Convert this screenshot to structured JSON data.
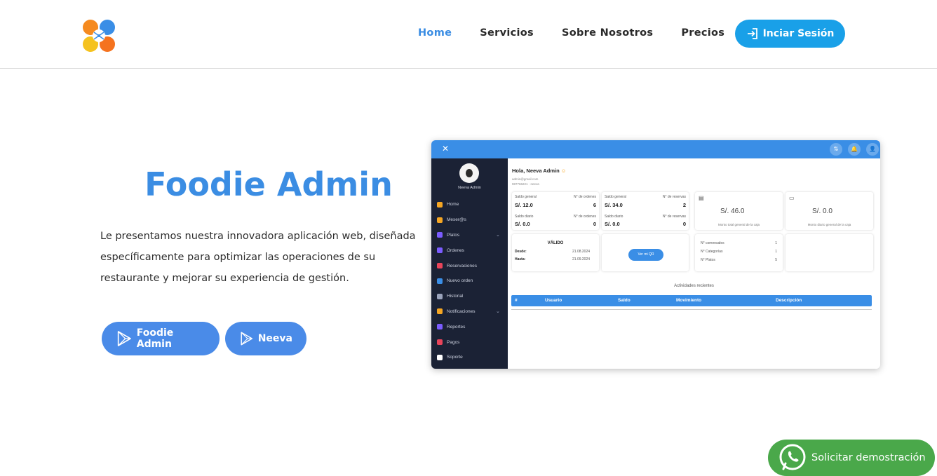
{
  "header": {
    "logo_icon": "foodie-logo-icon",
    "nav": [
      {
        "label": "Home",
        "active": true
      },
      {
        "label": "Servicios",
        "active": false
      },
      {
        "label": "Sobre Nosotros",
        "active": false
      },
      {
        "label": "Precios",
        "active": false
      }
    ],
    "login_label": "Inciar Sesión"
  },
  "hero": {
    "title": "Foodie Admin",
    "text": "Le presentamos nuestra innovadora aplicación web, diseñada específicamente para optimizar las operaciones de su restaurante y mejorar su experiencia de gestión.",
    "buttons": [
      {
        "label": "Foodie Admin",
        "icon": "play-store-icon"
      },
      {
        "label": "Neeva",
        "icon": "play-store-icon"
      }
    ]
  },
  "mockup": {
    "sidebar_user": "Neeva Admin",
    "menu": [
      {
        "label": "Home",
        "color": "#f5a623"
      },
      {
        "label": "Meser@s",
        "color": "#f5a623"
      },
      {
        "label": "Platos",
        "color": "#7b5cff",
        "expand": true
      },
      {
        "label": "Ordenes",
        "color": "#7b5cff"
      },
      {
        "label": "Reservaciones",
        "color": "#e8445a"
      },
      {
        "label": "Nuevo orden",
        "color": "#3a8ee6"
      },
      {
        "label": "Historial",
        "color": "#9aa3bb"
      },
      {
        "label": "Notificaciones",
        "color": "#f5a623",
        "expand": true
      },
      {
        "label": "Reportes",
        "color": "#7b5cff"
      },
      {
        "label": "Pagos",
        "color": "#e8445a"
      },
      {
        "label": "Soporte",
        "color": "#ffffff"
      }
    ],
    "greeting": "Hola, Neeva Admin",
    "email": "admin@gmail.com",
    "phone": "987766221 · neeva",
    "cards": {
      "saldo1_label": "Saldo general",
      "ordenes_label": "N° de ordenes",
      "saldo1_value": "S/. 12.0",
      "ordenes_value": "6",
      "diario1_label": "Saldo diario",
      "ordenesd_label": "N° de ordenes",
      "diario1_value": "S/. 0.0",
      "ordenesd_value": "0",
      "saldo2_label": "Saldo general",
      "reservas_label": "N° de reservas",
      "saldo2_value": "S/. 34.0",
      "reservas_value": "2",
      "diario2_label": "Saldo diario",
      "reservasd_label": "N° de reservas",
      "diario2_value": "S/. 0.0",
      "reservasd_value": "0",
      "caja_value": "S/. 46.0",
      "caja_caption": "Monto total general de la caja",
      "diario_caja_value": "S/. 0.0",
      "diario_caja_caption": "Monto diario general de la caja",
      "valido_label": "VÁLIDO",
      "desde_label": "Desde:",
      "desde_value": "21.08.2024",
      "hasta_label": "Hasta:",
      "hasta_value": "21.09.2024",
      "qr_label": "Ver mi QR",
      "stats": [
        {
          "label": "N° comensales",
          "value": "1"
        },
        {
          "label": "N° Categorías",
          "value": "1"
        },
        {
          "label": "N° Platos",
          "value": "5"
        }
      ]
    },
    "activity_title": "Actividades recientes",
    "table_headers": [
      "#",
      "Usuario",
      "Saldo",
      "Movimiento",
      "Descripción"
    ]
  },
  "whatsapp": {
    "label": "Solicitar demostración",
    "icon": "whatsapp-icon"
  }
}
